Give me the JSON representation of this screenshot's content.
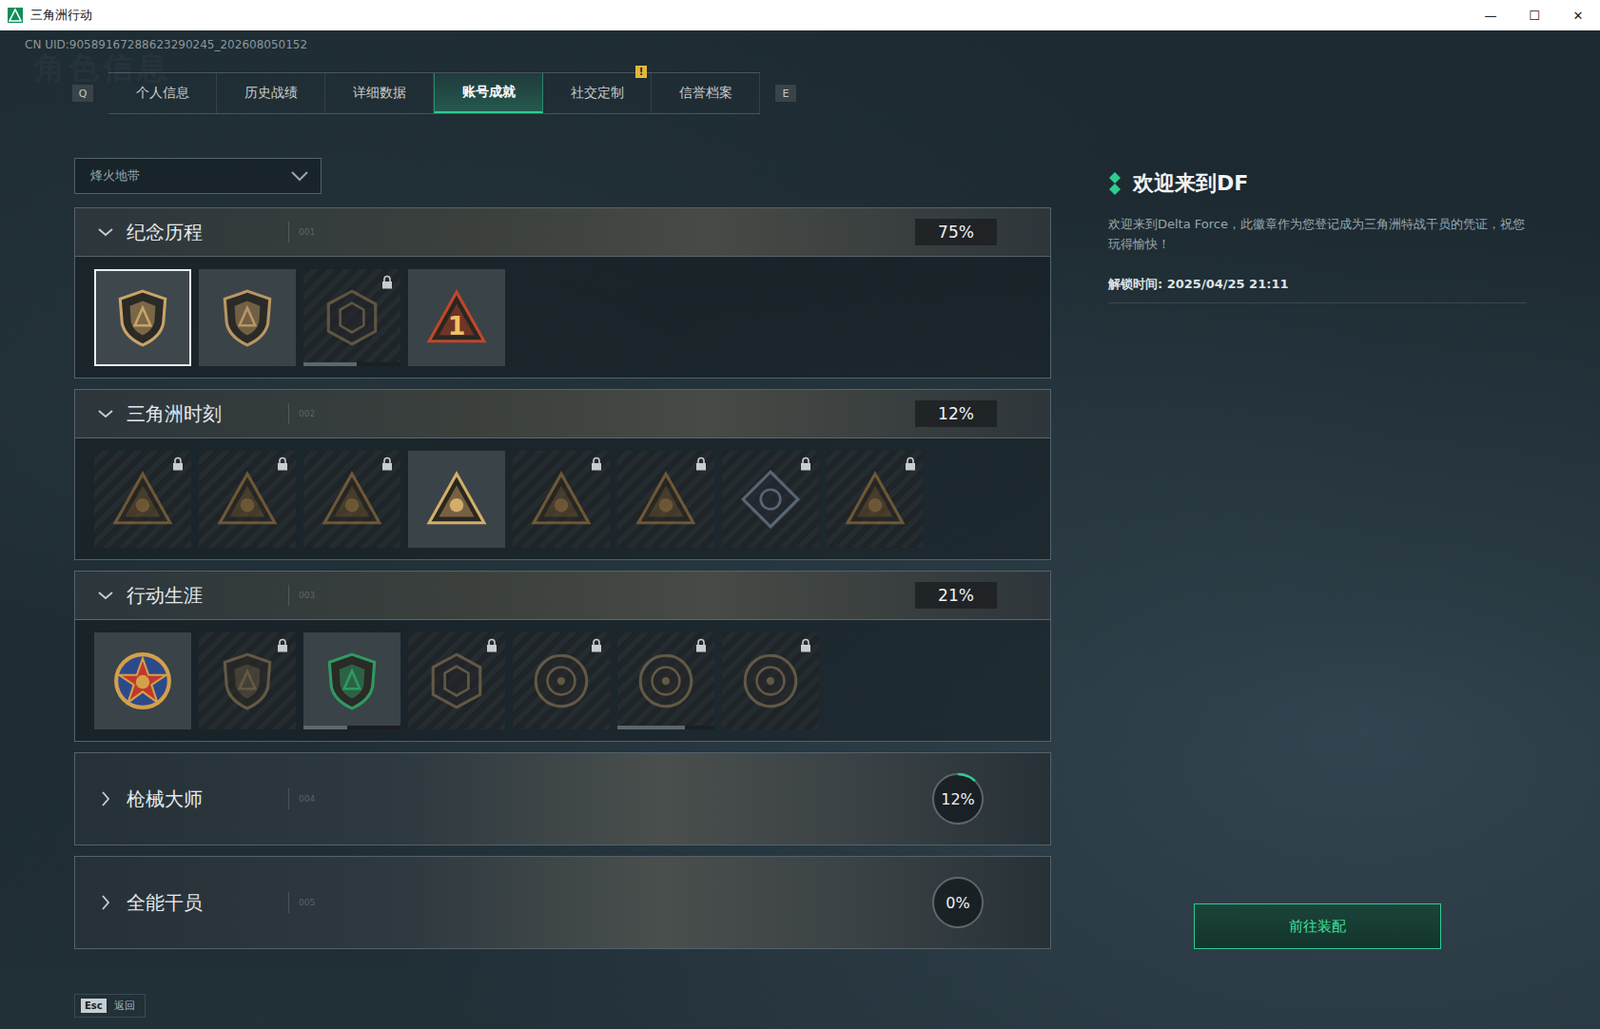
{
  "window": {
    "title": "三角洲行动",
    "controls": [
      "—",
      "☐",
      "✕"
    ]
  },
  "uid": "CN UID:90589167288623290245_202608050152",
  "watermark": "角色信息",
  "tabs": {
    "prev_key": "Q",
    "next_key": "E",
    "alert_mark": "!",
    "items": [
      {
        "label": "个人信息",
        "selected": false,
        "alert": false
      },
      {
        "label": "历史战绩",
        "selected": false,
        "alert": false
      },
      {
        "label": "详细数据",
        "selected": false,
        "alert": false
      },
      {
        "label": "账号成就",
        "selected": true,
        "alert": false
      },
      {
        "label": "社交定制",
        "selected": false,
        "alert": true
      },
      {
        "label": "信誉档案",
        "selected": false,
        "alert": false
      }
    ]
  },
  "mode_select": {
    "value": "烽火地带"
  },
  "sections": [
    {
      "title": "纪念历程",
      "index": "001",
      "percent": "75%",
      "level": 0.75,
      "expanded": true,
      "badges": [
        {
          "kind": "shield",
          "locked": false,
          "selected": true,
          "color": "#c9a468"
        },
        {
          "kind": "shield",
          "locked": false,
          "selected": false,
          "color": "#b89664"
        },
        {
          "kind": "hex",
          "locked": true,
          "selected": false,
          "color": "#8a7550",
          "level": 0.55
        },
        {
          "kind": "triangle",
          "locked": false,
          "selected": false,
          "color": "#c0462c",
          "mark": "1"
        }
      ]
    },
    {
      "title": "三角洲时刻",
      "index": "002",
      "percent": "12%",
      "level": 0.12,
      "expanded": true,
      "badges": [
        {
          "kind": "triangle",
          "locked": true,
          "selected": false,
          "color": "#a0783c"
        },
        {
          "kind": "triangle",
          "locked": true,
          "selected": false,
          "color": "#a0783c"
        },
        {
          "kind": "triangle",
          "locked": true,
          "selected": false,
          "color": "#a0783c"
        },
        {
          "kind": "triangle",
          "locked": false,
          "selected": false,
          "color": "#d2ae6a"
        },
        {
          "kind": "triangle",
          "locked": true,
          "selected": false,
          "color": "#a0783c"
        },
        {
          "kind": "triangle",
          "locked": true,
          "selected": false,
          "color": "#a0783c"
        },
        {
          "kind": "diamond",
          "locked": true,
          "selected": false,
          "color": "#7f8fa6"
        },
        {
          "kind": "triangle",
          "locked": true,
          "selected": false,
          "color": "#a0783c"
        }
      ]
    },
    {
      "title": "行动生涯",
      "index": "003",
      "percent": "21%",
      "level": 0.21,
      "expanded": true,
      "badges": [
        {
          "kind": "star",
          "locked": false,
          "selected": false,
          "color": "#d4a04a"
        },
        {
          "kind": "shield",
          "locked": true,
          "selected": false,
          "color": "#8f7a55"
        },
        {
          "kind": "shield",
          "locked": false,
          "selected": false,
          "color": "#2e9a62",
          "level": 0.45
        },
        {
          "kind": "hex",
          "locked": true,
          "selected": false,
          "color": "#8f7a55"
        },
        {
          "kind": "round",
          "locked": true,
          "selected": false,
          "color": "#8f7a55"
        },
        {
          "kind": "round",
          "locked": true,
          "selected": false,
          "color": "#8f7a55",
          "level": 0.7
        },
        {
          "kind": "round",
          "locked": true,
          "selected": false,
          "color": "#8f7a55"
        }
      ]
    },
    {
      "title": "枪械大师",
      "index": "004",
      "percent": "12%",
      "level": 0.12,
      "expanded": false,
      "badges": []
    },
    {
      "title": "全能干员",
      "index": "005",
      "percent": "0%",
      "level": 0,
      "expanded": false,
      "badges": []
    }
  ],
  "detail": {
    "title": "欢迎来到DF",
    "description": "欢迎来到Delta Force，此徽章作为您登记成为三角洲特战干员的凭证，祝您玩得愉快！",
    "unlock_time": "解锁时间: 2025/04/25 21:11",
    "button": "前往装配"
  },
  "footer": {
    "key": "Esc",
    "label": "返回"
  }
}
